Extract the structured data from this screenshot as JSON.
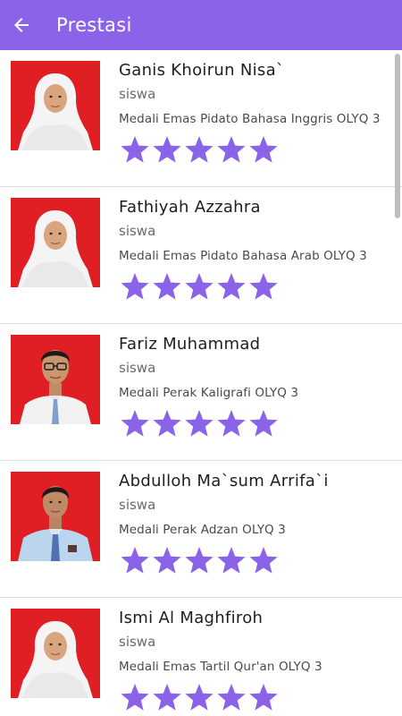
{
  "appbar": {
    "title": "Prestasi",
    "color": "#8a63e8",
    "back_icon": "arrow-left-icon"
  },
  "theme": {
    "star_color": "#8a63e8",
    "photo_background": "#e01f24"
  },
  "students": [
    {
      "name": "Ganis Khoirun Nisa`",
      "role": "siswa",
      "award": "Medali Emas Pidato Bahasa Inggris OLYQ 3",
      "rating": 5,
      "photo": "female-hijab"
    },
    {
      "name": "Fathiyah Azzahra",
      "role": "siswa",
      "award": "Medali Emas Pidato Bahasa Arab OLYQ 3",
      "rating": 5,
      "photo": "female-hijab"
    },
    {
      "name": "Fariz Muhammad",
      "role": "siswa",
      "award": "Medali Perak Kaligrafi OLYQ 3",
      "rating": 5,
      "photo": "male-glasses"
    },
    {
      "name": "Abdulloh Ma`sum Arrifa`i",
      "role": "siswa",
      "award": "Medali Perak Adzan OLYQ 3",
      "rating": 5,
      "photo": "male-blue-shirt"
    },
    {
      "name": "Ismi Al Maghfiroh",
      "role": "siswa",
      "award": "Medali Emas Tartil Qur'an OLYQ 3",
      "rating": 5,
      "photo": "female-hijab"
    }
  ]
}
